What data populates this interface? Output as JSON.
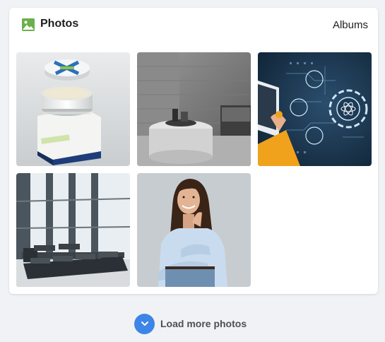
{
  "header": {
    "title": "Photos",
    "albums_label": "Albums",
    "icon": "image-icon",
    "icon_color": "#6ab04c"
  },
  "photos": [
    {
      "name": "acne-fade-cream-jar"
    },
    {
      "name": "grayscale-bathroom-interior"
    },
    {
      "name": "science-technology-hud"
    },
    {
      "name": "airport-lounge-seating"
    },
    {
      "name": "smiling-woman-portrait"
    }
  ],
  "load_more": {
    "label": "Load more photos",
    "icon": "chevron-down-icon",
    "accent": "#3d85e6"
  }
}
